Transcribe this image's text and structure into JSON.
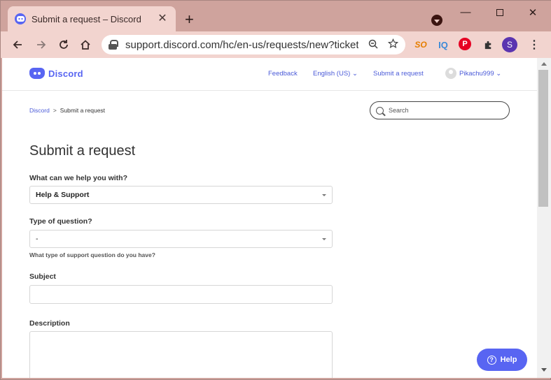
{
  "browser": {
    "tab_title": "Submit a request – Discord",
    "tab_close": "✕",
    "new_tab": "+",
    "url": "support.discord.com/hc/en-us/requests/new?ticket...",
    "window_controls": {
      "minimize": "—",
      "close": "✕"
    },
    "extensions": {
      "so": "SO",
      "iq": "IQ",
      "pinterest": "P",
      "avatar": "S",
      "menu": "⋮"
    }
  },
  "header": {
    "logo_text": "Discord",
    "nav": {
      "feedback": "Feedback",
      "language": "English (US) ⌄",
      "submit_request": "Submit a request"
    },
    "user_name": "Pikachu999 ⌄"
  },
  "breadcrumb": {
    "home": "Discord",
    "separator": ">",
    "current": "Submit a request"
  },
  "search": {
    "placeholder": "Search"
  },
  "form": {
    "title": "Submit a request",
    "help_with_label": "What can we help you with?",
    "help_with_value": "Help & Support",
    "question_type_label": "Type of question?",
    "question_type_value": "-",
    "question_type_hint": "What type of support question do you have?",
    "subject_label": "Subject",
    "description_label": "Description"
  },
  "help_button": {
    "label": "Help",
    "icon": "?"
  },
  "colors": {
    "brand": "#5865f2",
    "chrome": "#cfa39d",
    "tab": "#f2d4cf"
  }
}
